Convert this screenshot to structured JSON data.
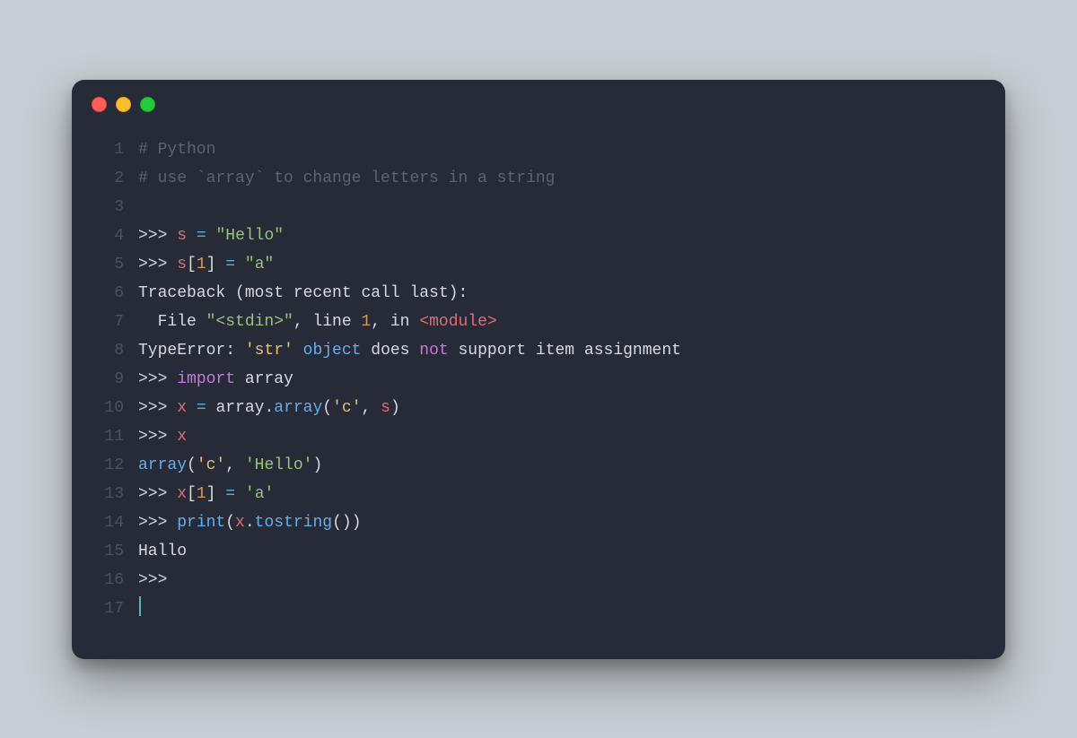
{
  "window": {
    "traffic_lights": [
      "close",
      "minimize",
      "zoom"
    ]
  },
  "code": {
    "lines": [
      {
        "n": 1,
        "tokens": [
          {
            "c": "cmt",
            "t": "# Python"
          }
        ]
      },
      {
        "n": 2,
        "tokens": [
          {
            "c": "cmt",
            "t": "# use `array` to change letters in a string"
          }
        ]
      },
      {
        "n": 3,
        "tokens": []
      },
      {
        "n": 4,
        "tokens": [
          {
            "c": "prm",
            "t": ">>> "
          },
          {
            "c": "var",
            "t": "s"
          },
          {
            "c": "txt",
            "t": " "
          },
          {
            "c": "op",
            "t": "="
          },
          {
            "c": "txt",
            "t": " "
          },
          {
            "c": "str",
            "t": "\"Hello\""
          }
        ]
      },
      {
        "n": 5,
        "tokens": [
          {
            "c": "prm",
            "t": ">>> "
          },
          {
            "c": "var",
            "t": "s"
          },
          {
            "c": "pun",
            "t": "["
          },
          {
            "c": "num",
            "t": "1"
          },
          {
            "c": "pun",
            "t": "]"
          },
          {
            "c": "txt",
            "t": " "
          },
          {
            "c": "op",
            "t": "="
          },
          {
            "c": "txt",
            "t": " "
          },
          {
            "c": "str",
            "t": "\"a\""
          }
        ]
      },
      {
        "n": 6,
        "tokens": [
          {
            "c": "txt",
            "t": "Traceback (most recent call last):"
          }
        ]
      },
      {
        "n": 7,
        "tokens": [
          {
            "c": "txt",
            "t": "  File "
          },
          {
            "c": "str",
            "t": "\"<stdin>\""
          },
          {
            "c": "txt",
            "t": ", line "
          },
          {
            "c": "num",
            "t": "1"
          },
          {
            "c": "txt",
            "t": ", in "
          },
          {
            "c": "var",
            "t": "<module>"
          }
        ]
      },
      {
        "n": 8,
        "tokens": [
          {
            "c": "txt",
            "t": "TypeError: "
          },
          {
            "c": "stry",
            "t": "'str'"
          },
          {
            "c": "txt",
            "t": " "
          },
          {
            "c": "fn",
            "t": "object"
          },
          {
            "c": "txt",
            "t": " does "
          },
          {
            "c": "kw",
            "t": "not"
          },
          {
            "c": "txt",
            "t": " support item assignment"
          }
        ]
      },
      {
        "n": 9,
        "tokens": [
          {
            "c": "prm",
            "t": ">>> "
          },
          {
            "c": "kw",
            "t": "import"
          },
          {
            "c": "txt",
            "t": " array"
          }
        ]
      },
      {
        "n": 10,
        "tokens": [
          {
            "c": "prm",
            "t": ">>> "
          },
          {
            "c": "var",
            "t": "x"
          },
          {
            "c": "txt",
            "t": " "
          },
          {
            "c": "op",
            "t": "="
          },
          {
            "c": "txt",
            "t": " array."
          },
          {
            "c": "fn",
            "t": "array"
          },
          {
            "c": "pun",
            "t": "("
          },
          {
            "c": "stry",
            "t": "'c'"
          },
          {
            "c": "pun",
            "t": ", "
          },
          {
            "c": "var",
            "t": "s"
          },
          {
            "c": "pun",
            "t": ")"
          }
        ]
      },
      {
        "n": 11,
        "tokens": [
          {
            "c": "prm",
            "t": ">>> "
          },
          {
            "c": "var",
            "t": "x"
          }
        ]
      },
      {
        "n": 12,
        "tokens": [
          {
            "c": "fn",
            "t": "array"
          },
          {
            "c": "pun",
            "t": "("
          },
          {
            "c": "stry",
            "t": "'c'"
          },
          {
            "c": "pun",
            "t": ", "
          },
          {
            "c": "str",
            "t": "'Hello'"
          },
          {
            "c": "pun",
            "t": ")"
          }
        ]
      },
      {
        "n": 13,
        "tokens": [
          {
            "c": "prm",
            "t": ">>> "
          },
          {
            "c": "var",
            "t": "x"
          },
          {
            "c": "pun",
            "t": "["
          },
          {
            "c": "num",
            "t": "1"
          },
          {
            "c": "pun",
            "t": "]"
          },
          {
            "c": "txt",
            "t": " "
          },
          {
            "c": "op",
            "t": "="
          },
          {
            "c": "txt",
            "t": " "
          },
          {
            "c": "str",
            "t": "'a'"
          }
        ]
      },
      {
        "n": 14,
        "tokens": [
          {
            "c": "prm",
            "t": ">>> "
          },
          {
            "c": "fn",
            "t": "print"
          },
          {
            "c": "pun",
            "t": "("
          },
          {
            "c": "var",
            "t": "x"
          },
          {
            "c": "pun",
            "t": "."
          },
          {
            "c": "fn",
            "t": "tostring"
          },
          {
            "c": "pun",
            "t": "())"
          }
        ]
      },
      {
        "n": 15,
        "tokens": [
          {
            "c": "txt",
            "t": "Hallo"
          }
        ]
      },
      {
        "n": 16,
        "tokens": [
          {
            "c": "prm",
            "t": ">>>"
          }
        ]
      },
      {
        "n": 17,
        "tokens": [],
        "cursor": true
      }
    ]
  }
}
